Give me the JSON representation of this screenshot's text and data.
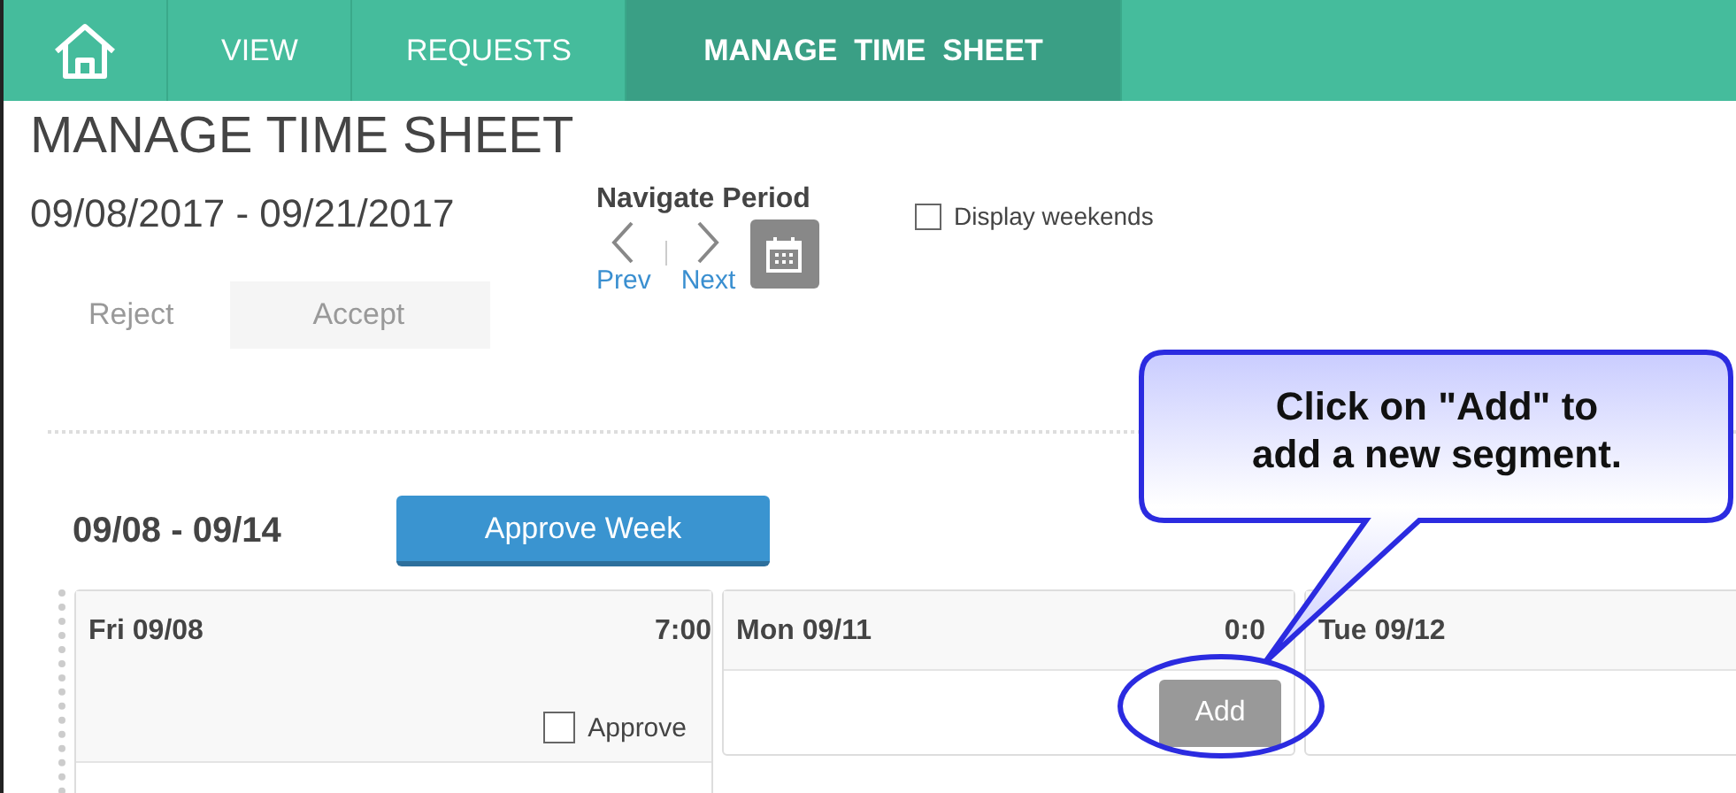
{
  "nav": {
    "tabs": [
      {
        "label": "VIEW",
        "selected": false
      },
      {
        "label": "REQUESTS",
        "selected": false
      },
      {
        "label": "MANAGE  TIME  SHEET",
        "selected": true
      }
    ]
  },
  "page_title": "MANAGE TIME SHEET",
  "period": "09/08/2017 - 09/21/2017",
  "navigate_period": {
    "label": "Navigate Period",
    "prev": "Prev",
    "next": "Next"
  },
  "display_weekends": {
    "label": "Display weekends",
    "checked": false
  },
  "actions": [
    {
      "label": "Reject",
      "kind": "link"
    },
    {
      "label": "Accept",
      "kind": "box"
    }
  ],
  "week": {
    "label": "09/08 - 09/14",
    "approve_button": "Approve Week"
  },
  "days": [
    {
      "kind": "approvable",
      "label": "Fri 09/08",
      "total": "7:00",
      "approve": {
        "label": "Approve",
        "checked": false
      }
    },
    {
      "kind": "add",
      "label": "Mon 09/11",
      "total": "0:0",
      "add_button": "Add"
    },
    {
      "kind": "plain",
      "label": "Tue 09/12"
    }
  ],
  "callout": {
    "text": "Click on \"Add\" to\nadd a new segment."
  }
}
